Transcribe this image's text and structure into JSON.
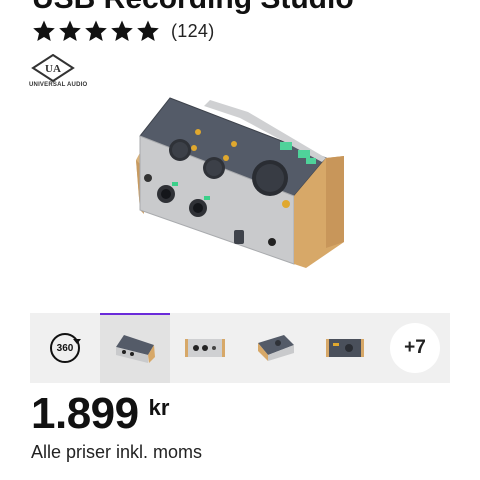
{
  "product": {
    "title": "USB Recording Studio",
    "rating": {
      "stars": 5,
      "max_stars": 5,
      "count": "(124)"
    },
    "brand": {
      "logo_text": "UA",
      "name": "UNIVERSAL AUDIO"
    }
  },
  "gallery": {
    "view_360_label": "360",
    "active_index": 0,
    "thumbnails": [
      "front-angle view",
      "front view",
      "rear-angle view",
      "top view"
    ],
    "more_label": "+7"
  },
  "price": {
    "value": "1.899",
    "currency": "kr",
    "note": "Alle priser inkl. moms"
  },
  "colors": {
    "text": "#111111",
    "accent": "#6a2bd9",
    "strip_bg": "#f0f0f0",
    "thumb_active_bg": "#e2e2e2"
  },
  "icons": {
    "star": "star-icon",
    "view_360": "rotate-360-icon"
  }
}
